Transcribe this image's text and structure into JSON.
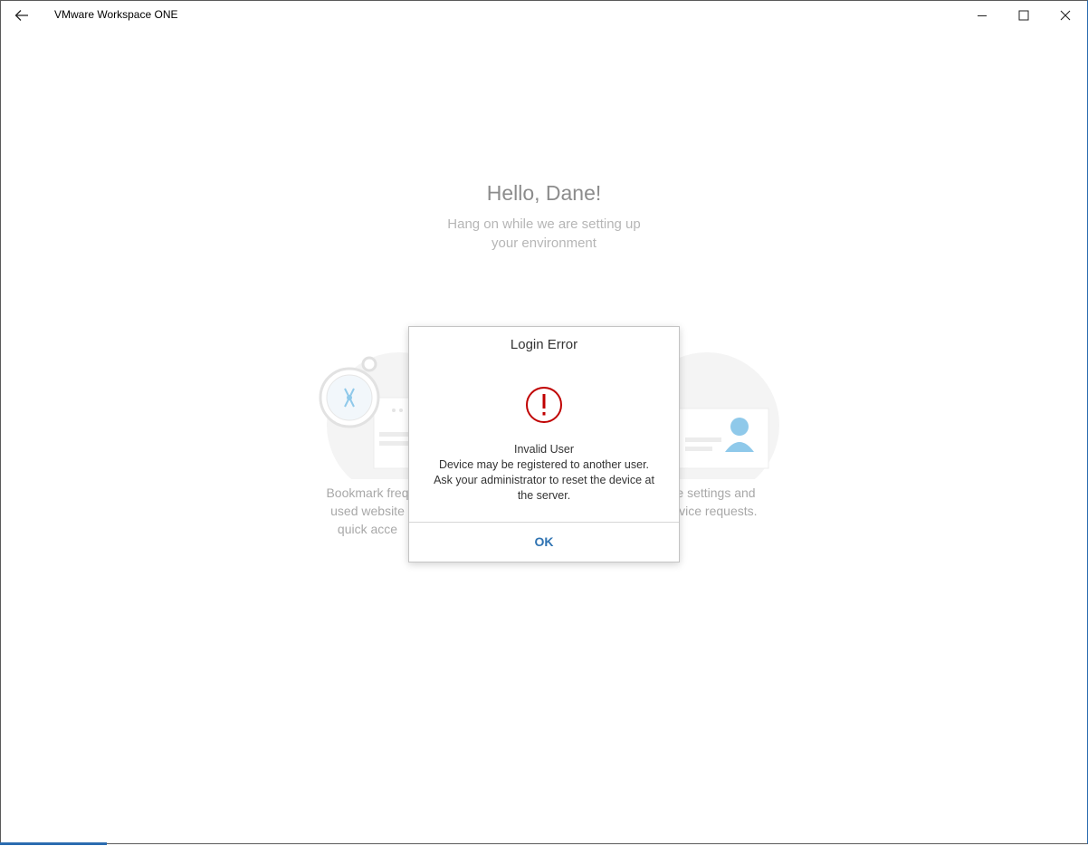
{
  "window": {
    "title": "VMware Workspace ONE",
    "controls": {
      "minimize": "minimize-icon",
      "maximize": "maximize-icon",
      "close": "close-icon"
    },
    "back": "back-arrow-icon"
  },
  "main": {
    "greeting": "Hello, Dane!",
    "subtitle_line1": "Hang on while we are setting up",
    "subtitle_line2": "your environment",
    "cards": [
      {
        "icon": "compass-bookmark-illustration",
        "line1": "Bookmark freq",
        "line2": "used website",
        "line3": "quick acce"
      },
      {
        "icon": "user-profile-illustration",
        "line1": "e settings and",
        "line2": "rvice requests."
      }
    ]
  },
  "dialog": {
    "title": "Login Error",
    "icon": "error-exclamation-icon",
    "msg_line1": "Invalid User",
    "msg_line2": "Device may be registered to another user.",
    "msg_line3": "Ask your administrator to reset the device at",
    "msg_line4": "the server.",
    "ok_label": "OK"
  },
  "colors": {
    "accent": "#2f73b2",
    "error": "#c00000",
    "muted_text": "#a8a8a8",
    "illustration_blue": "#8fc9ea"
  }
}
